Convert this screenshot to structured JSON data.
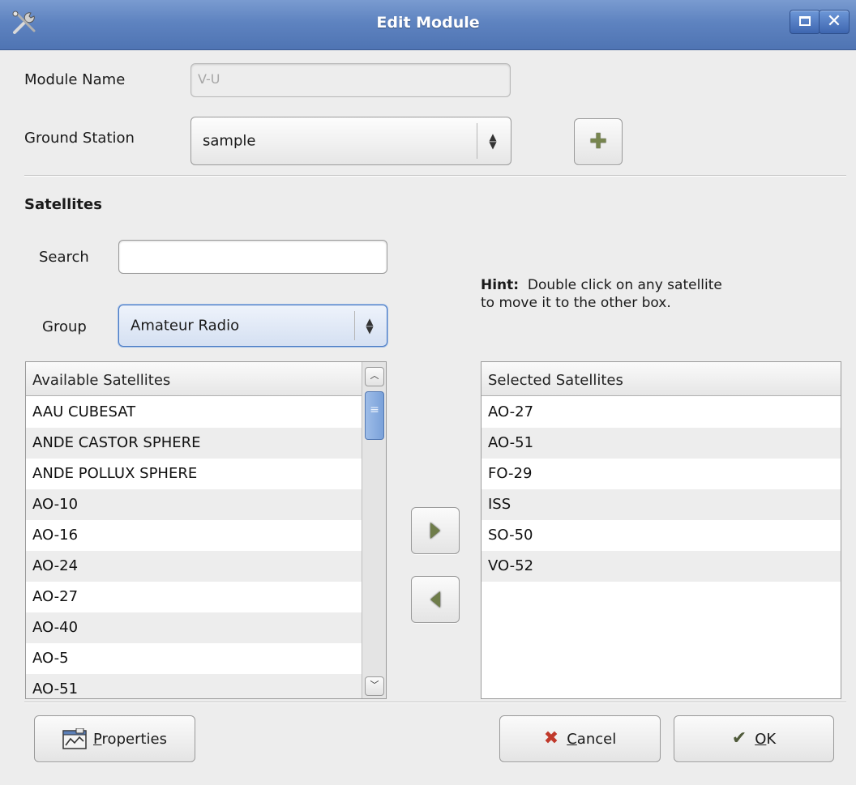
{
  "window": {
    "title": "Edit Module"
  },
  "form": {
    "module_name_label": "Module Name",
    "module_name_value": "V-U",
    "ground_station_label": "Ground Station",
    "ground_station_value": "sample"
  },
  "satellites": {
    "heading": "Satellites",
    "search_label": "Search",
    "search_value": "",
    "group_label": "Group",
    "group_value": "Amateur Radio",
    "hint_bold": "Hint:",
    "hint_line1": "Double click on any satellite",
    "hint_line2": "to move it to the other box.",
    "available_header": "Available Satellites",
    "available": [
      "AAU CUBESAT",
      "ANDE CASTOR SPHERE",
      "ANDE POLLUX SPHERE",
      "AO-10",
      "AO-16",
      "AO-24",
      "AO-27",
      "AO-40",
      "AO-5",
      "AO-51"
    ],
    "selected_header": "Selected Satellites",
    "selected": [
      "AO-27",
      "AO-51",
      "FO-29",
      "ISS",
      "SO-50",
      "VO-52"
    ]
  },
  "buttons": {
    "properties_mnemonic": "P",
    "properties_rest": "roperties",
    "cancel_mnemonic": "C",
    "cancel_rest": "ancel",
    "ok_mnemonic": "O",
    "ok_rest": "K"
  },
  "icons": {
    "app": "tools-icon",
    "add_station": "plus-icon",
    "move_right": "arrow-right-icon",
    "move_left": "arrow-left-icon",
    "properties": "properties-icon",
    "cancel": "cancel-x-icon",
    "ok": "checkmark-icon"
  },
  "colors": {
    "titlebar": "#5e83c0",
    "selection_focus": "#4a7bc4",
    "cancel_red": "#c0392b"
  }
}
